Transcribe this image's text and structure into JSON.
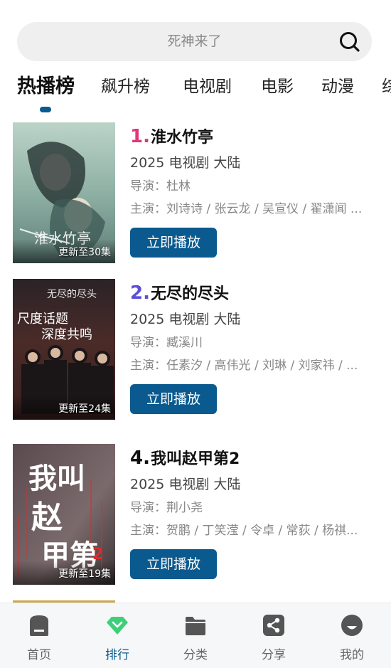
{
  "search": {
    "placeholder": "死神来了"
  },
  "tabs": [
    {
      "label": "热播榜",
      "active": true
    },
    {
      "label": "飙升榜"
    },
    {
      "label": "电视剧"
    },
    {
      "label": "电影"
    },
    {
      "label": "动漫"
    },
    {
      "label": "综"
    }
  ],
  "items": [
    {
      "rank": "1.",
      "rank_color": "#e0367a",
      "title": "淮水竹亭",
      "year": "2025",
      "type": "电视剧",
      "region": "大陆",
      "director": "导演：杜林",
      "cast": "主演：刘诗诗 / 张云龙 / 吴宣仪 / 翟潇闻 ...",
      "badge": "更新至30集",
      "button": "立即播放"
    },
    {
      "rank": "2.",
      "rank_color": "#5b4fd6",
      "title": "无尽的尽头",
      "year": "2025",
      "type": "电视剧",
      "region": "大陆",
      "director": "导演：臧溪川",
      "cast": "主演：任素汐 / 高伟光 / 刘琳 / 刘家祎 / ...",
      "badge": "更新至24集",
      "button": "立即播放"
    },
    {
      "rank": "4.",
      "rank_color": "#111111",
      "title": "我叫赵甲第2",
      "year": "2025",
      "type": "电视剧",
      "region": "大陆",
      "director": "导演：荆小尧",
      "cast": "主演：贺鹏 / 丁笑滢 / 令卓 / 常荻 / 杨祺...",
      "badge": "更新至19集",
      "button": "立即播放"
    }
  ],
  "nav": [
    {
      "label": "首页",
      "icon": "home-icon"
    },
    {
      "label": "排行",
      "icon": "rank-diamond-icon",
      "active": true
    },
    {
      "label": "分类",
      "icon": "folder-icon"
    },
    {
      "label": "分享",
      "icon": "share-icon"
    },
    {
      "label": "我的",
      "icon": "profile-icon"
    }
  ],
  "colors": {
    "accent": "#0a5a8f",
    "rank_green": "#3ecf7a"
  }
}
